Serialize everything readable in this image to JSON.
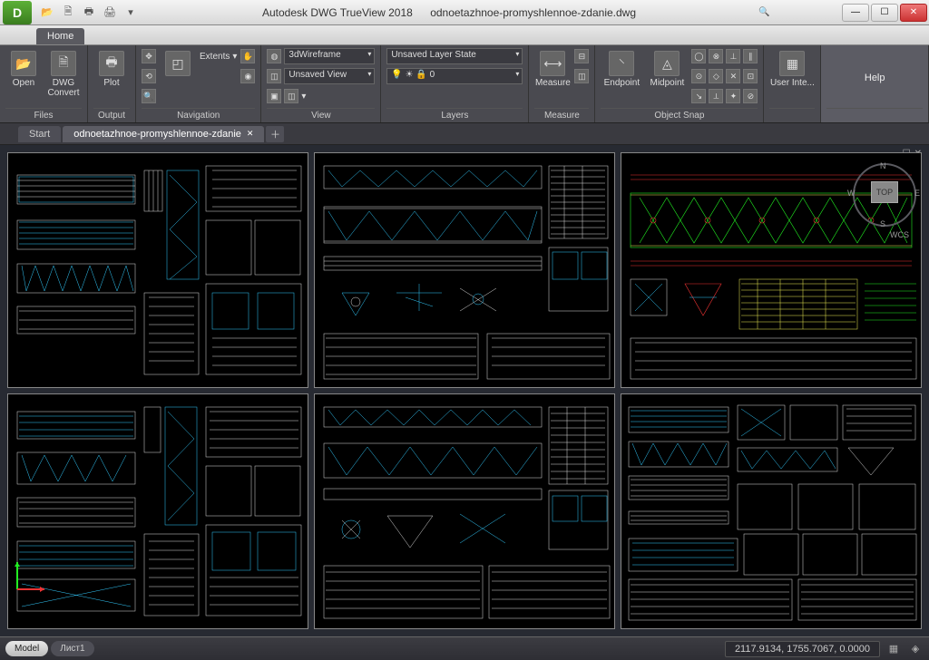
{
  "app": {
    "logo": "D",
    "title": "Autodesk DWG TrueView 2018",
    "document": "odnoetazhnoe-promyshlennoe-zdanie.dwg"
  },
  "ribbon": {
    "tab": "Home",
    "panels": {
      "files": {
        "title": "Files",
        "open": "Open",
        "convert": "DWG\nConvert"
      },
      "output": {
        "title": "Output",
        "plot": "Plot"
      },
      "navigation": {
        "title": "Navigation",
        "extents": "Extents"
      },
      "view": {
        "title": "View",
        "style": "3dWireframe",
        "saved": "Unsaved View"
      },
      "layers": {
        "title": "Layers",
        "state": "Unsaved Layer State",
        "current": "0"
      },
      "measure": {
        "title": "Measure",
        "btn": "Measure"
      },
      "osnap": {
        "title": "Object Snap",
        "endpoint": "Endpoint",
        "midpoint": "Midpoint"
      },
      "ui": {
        "label": "User Inte..."
      },
      "help": {
        "label": "Help"
      }
    }
  },
  "doctabs": {
    "start": "Start",
    "file": "odnoetazhnoe-promyshlennoe-zdanie"
  },
  "viewcube": {
    "face": "TOP",
    "n": "N",
    "s": "S",
    "e": "E",
    "w": "W",
    "wcs": "WCS"
  },
  "status": {
    "model": "Model",
    "layout": "Лист1",
    "coords": "2117.9134, 1755.7067, 0.0000"
  }
}
